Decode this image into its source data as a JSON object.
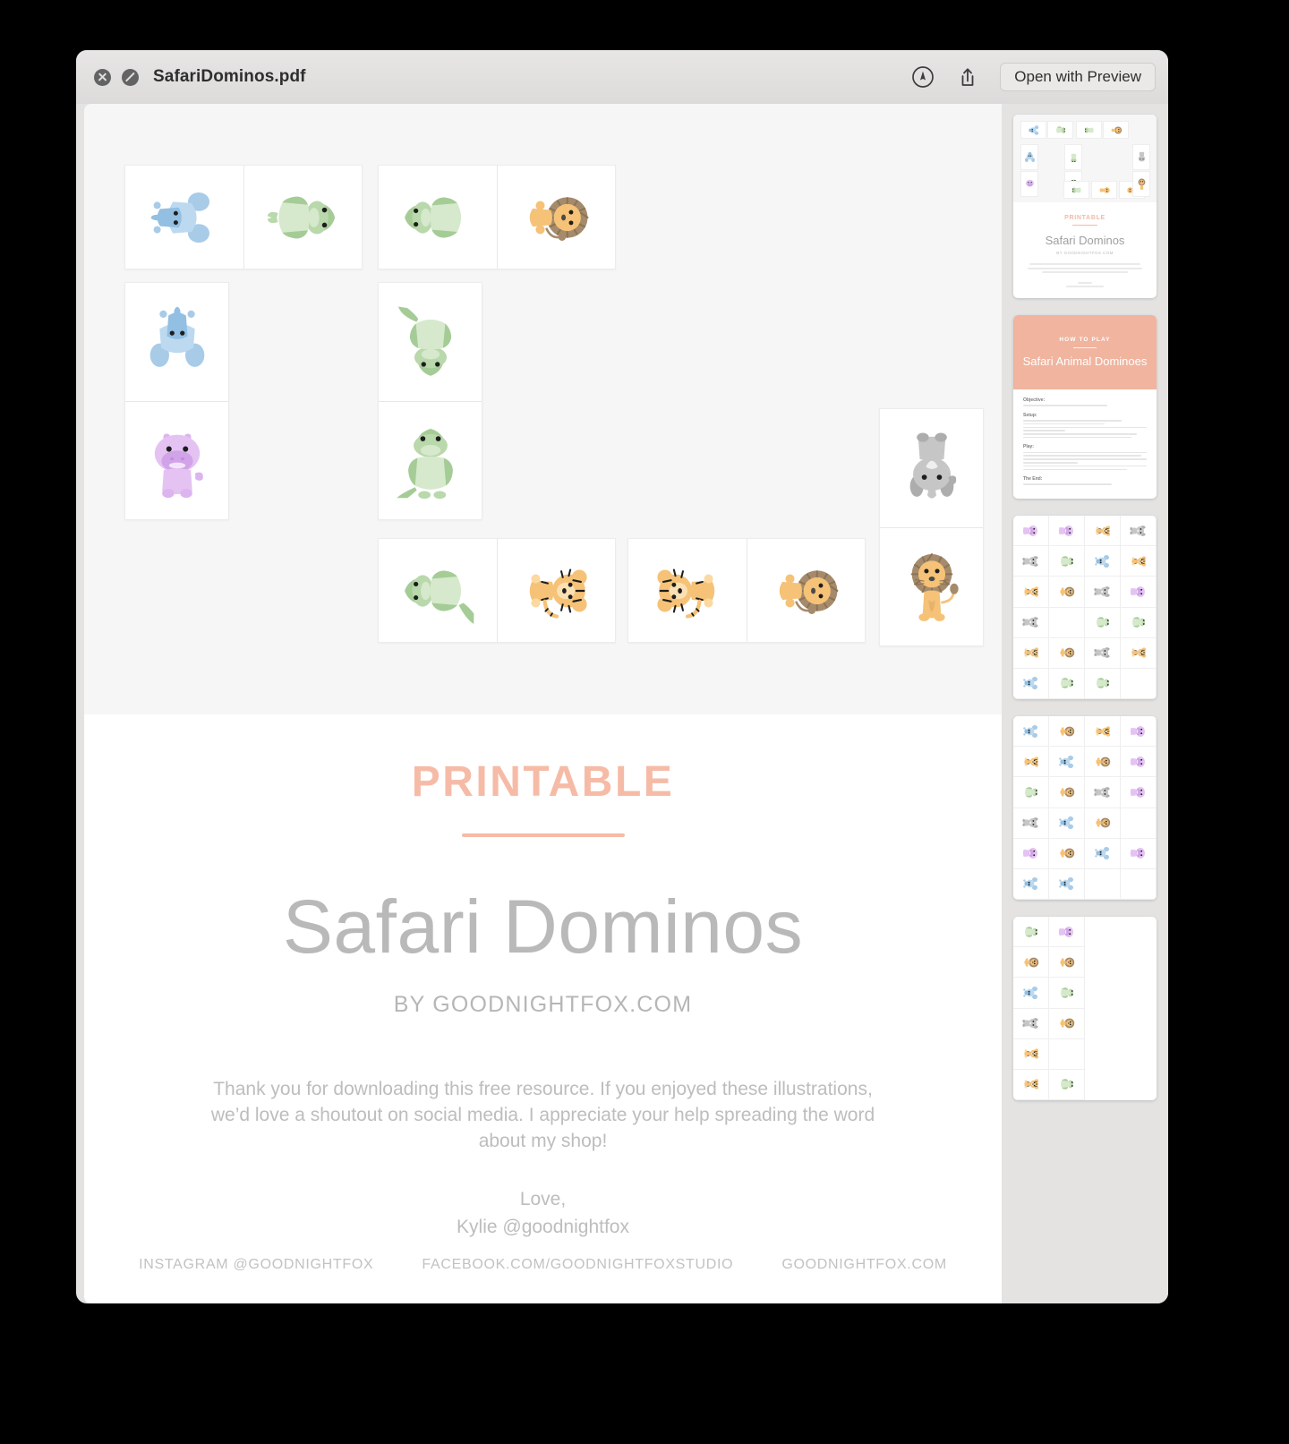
{
  "window": {
    "title": "SafariDominos.pdf",
    "close_icon": "close-circle-icon",
    "block_icon": "block-circle-icon",
    "markup_icon": "markup-pen-icon",
    "share_icon": "share-icon",
    "open_button_label": "Open with Preview"
  },
  "document": {
    "cover": {
      "eyebrow": "PRINTABLE",
      "title": "Safari Dominos",
      "byline": "BY GOODNIGHTFOX.COM",
      "body": "Thank you for downloading this free resource. If you enjoyed these illustrations, we’d love a shoutout on social media. I appreciate your help spreading the word about my shop!",
      "sign_off_1": "Love,",
      "sign_off_2": "Kylie @goodnightfox",
      "footer_links": [
        "INSTAGRAM @GOODNIGHTFOX",
        "FACEBOOK.COM/GOODNIGHTFOXSTUDIO",
        "GOODNIGHTFOX.COM"
      ]
    },
    "domino_cards": [
      {
        "orientation": "horizontal",
        "left": "elephant",
        "right": "crocodile"
      },
      {
        "orientation": "horizontal",
        "left": "crocodile",
        "right": "lion"
      },
      {
        "orientation": "vertical",
        "top": "elephant",
        "bottom": "hippo"
      },
      {
        "orientation": "vertical",
        "top": "crocodile",
        "bottom": "crocodile"
      },
      {
        "orientation": "horizontal",
        "left": "crocodile",
        "right": "tiger"
      },
      {
        "orientation": "horizontal",
        "left": "tiger",
        "right": "lion"
      },
      {
        "orientation": "vertical",
        "top": "rhino",
        "bottom": "lion"
      }
    ]
  },
  "thumbnails": [
    {
      "page": 1,
      "kind": "cover",
      "eyebrow": "PRINTABLE",
      "title": "Safari Dominos",
      "byline": "BY GOODNIGHTFOX.COM"
    },
    {
      "page": 2,
      "kind": "instructions",
      "header_eyebrow": "HOW TO PLAY",
      "header_title": "Safari Animal Dominoes",
      "sections": [
        "Objective:",
        "Setup:",
        "Play:",
        "The End:"
      ]
    },
    {
      "page": 3,
      "kind": "grid",
      "columns": 4,
      "rows": 6,
      "animals": [
        "hippo",
        "hippo",
        "tiger",
        "rhino",
        "rhino",
        "crocodile",
        "elephant",
        "tiger",
        "tiger",
        "lion",
        "rhino",
        "hippo",
        "rhino",
        "",
        "crocodile",
        "crocodile",
        "tiger",
        "lion",
        "rhino",
        "tiger",
        "elephant",
        "crocodile",
        "crocodile",
        ""
      ]
    },
    {
      "page": 4,
      "kind": "grid",
      "columns": 4,
      "rows": 6,
      "animals": [
        "elephant",
        "lion",
        "tiger",
        "hippo",
        "tiger",
        "elephant",
        "lion",
        "hippo",
        "crocodile",
        "lion",
        "rhino",
        "hippo",
        "rhino",
        "elephant",
        "lion",
        "",
        "hippo",
        "lion",
        "elephant",
        "hippo",
        "elephant",
        "elephant",
        "",
        ""
      ]
    },
    {
      "page": 5,
      "kind": "grid",
      "columns": 2,
      "rows": 6,
      "animals": [
        "crocodile",
        "hippo",
        "lion",
        "lion",
        "elephant",
        "crocodile",
        "rhino",
        "lion",
        "tiger",
        "",
        "tiger",
        "crocodile"
      ]
    }
  ],
  "colors": {
    "accent_salmon": "#f6bba6",
    "text_gray": "#b9b9b9",
    "window_chrome": "#e4e3e2"
  }
}
